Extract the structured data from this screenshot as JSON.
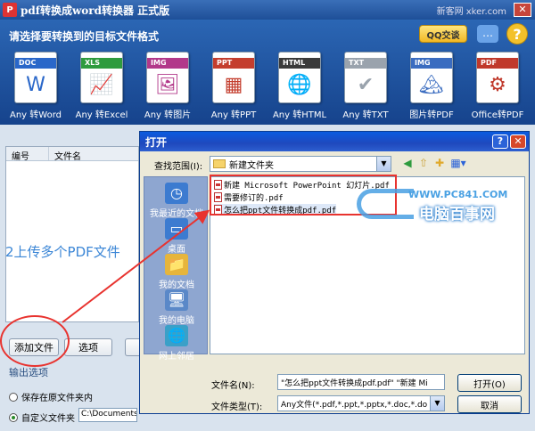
{
  "app": {
    "title": "pdf转换成word转换器 正式版",
    "watermark": "新客网 xker.com",
    "close_label": "✕"
  },
  "header": {
    "prompt": "请选择要转换到的目标文件格式",
    "qq_label": "QQ交谈",
    "chat_label": "…",
    "help_label": "?",
    "formats": [
      {
        "tag": "DOC",
        "label": "Any 转Word",
        "color": "#2a67c9",
        "glyph": "W"
      },
      {
        "tag": "XLS",
        "label": "Any 转Excel",
        "color": "#2e9b3e",
        "glyph": "📈"
      },
      {
        "tag": "IMG",
        "label": "Any 转图片",
        "color": "#b2388a",
        "glyph": "🖼"
      },
      {
        "tag": "PPT",
        "label": "Any 转PPT",
        "color": "#c43e2e",
        "glyph": "▦"
      },
      {
        "tag": "HTML",
        "label": "Any 转HTML",
        "color": "#3a3a3a",
        "glyph": "🌐"
      },
      {
        "tag": "TXT",
        "label": "Any 转TXT",
        "color": "#9aa3ad",
        "glyph": "✔"
      },
      {
        "tag": "IMG",
        "label": "图片转PDF",
        "color": "#3a6cc0",
        "glyph": "🏔"
      },
      {
        "tag": "PDF",
        "label": "Office转PDF",
        "color": "#c0392b",
        "glyph": "⚙"
      }
    ]
  },
  "left": {
    "col_no": "编号",
    "col_name": "文件名",
    "upload_hint": "2上传多个PDF文件",
    "add_file": "添加文件",
    "options": "选项",
    "output_title": "输出选项",
    "keep_original": "保存在原文件夹内",
    "custom_folder": "自定义文件夹",
    "custom_path": "C:\\Documents a"
  },
  "dialog": {
    "title": "打开",
    "help": "?",
    "close": "✕",
    "look_in_label": "查找范围(I):",
    "look_in_value": "新建文件夹",
    "places": [
      "我最近的文档",
      "桌面",
      "我的文档",
      "我的电脑",
      "网上邻居"
    ],
    "files": [
      "新建 Microsoft PowerPoint 幻灯片.pdf",
      "需要修订的.pdf",
      "怎么把ppt文件转换成pdf.pdf"
    ],
    "filename_label": "文件名(N):",
    "filename_value": "\"怎么把ppt文件转换成pdf.pdf\" \"新建 Mi",
    "filetype_label": "文件类型(T):",
    "filetype_value": "Any文件(*.pdf,*.ppt,*.pptx,*.doc,*.do",
    "open_btn": "打开(O)",
    "cancel_btn": "取消"
  },
  "watermark": {
    "url": "WWW.PC841.COM",
    "brand": "电脑百事网"
  }
}
